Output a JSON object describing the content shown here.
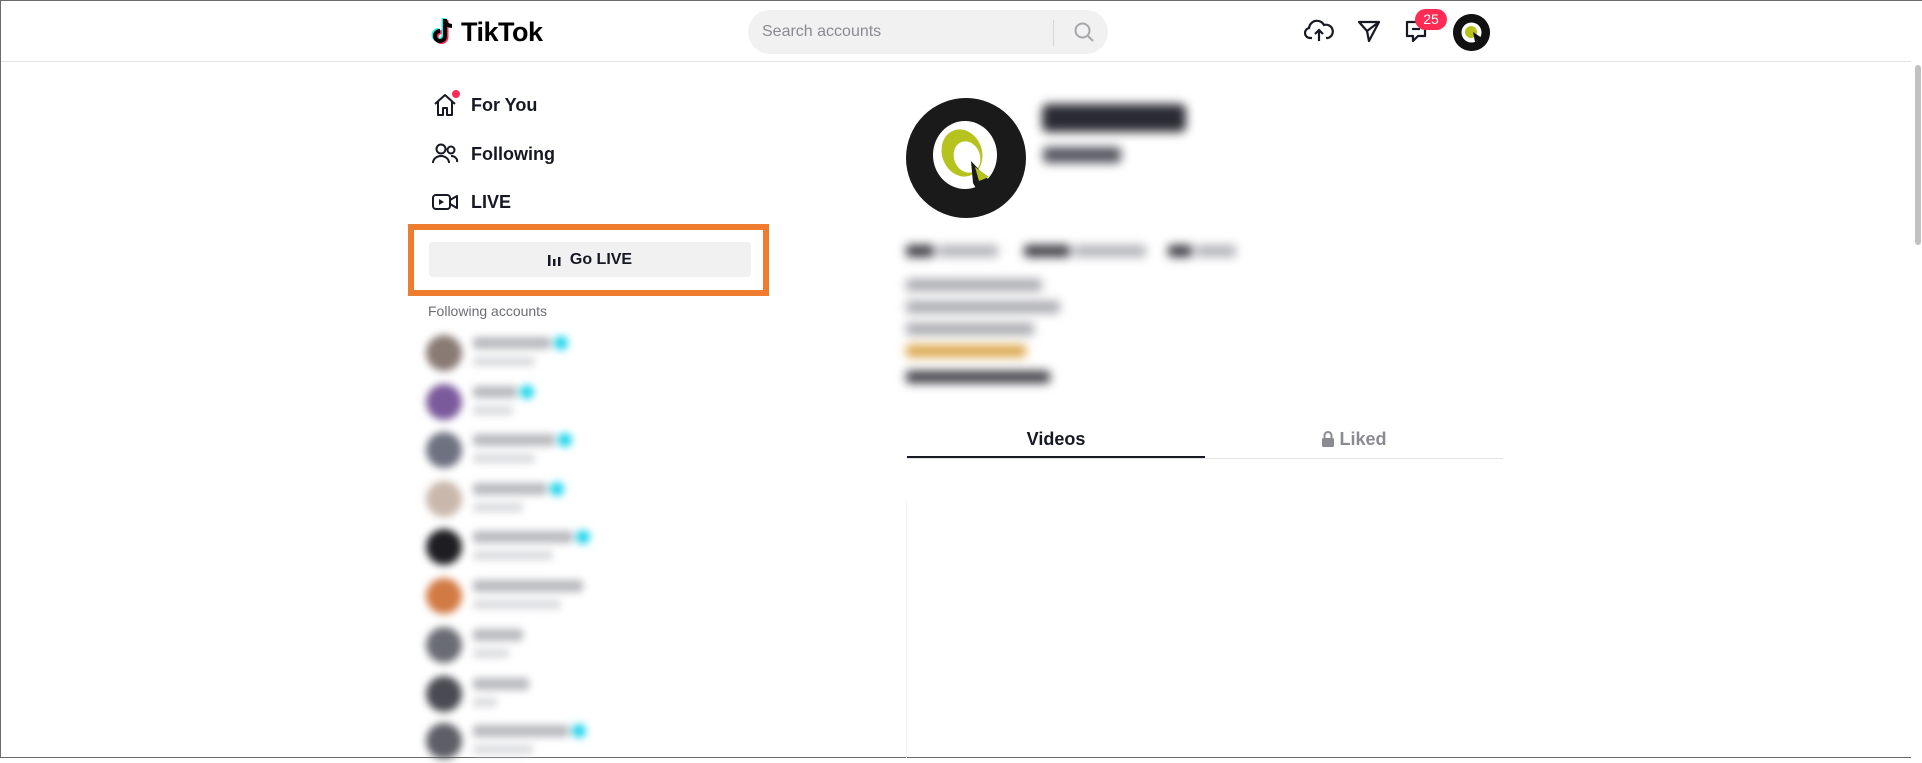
{
  "header": {
    "logo_text": "TikTok",
    "search": {
      "placeholder": "Search accounts"
    },
    "inbox_badge": "25",
    "icons": [
      "upload-icon",
      "send-icon",
      "inbox-icon",
      "search-icon"
    ]
  },
  "sidebar": {
    "nav": [
      {
        "label": "For You",
        "icon": "home-icon",
        "has_dot": true
      },
      {
        "label": "Following",
        "icon": "people-icon"
      },
      {
        "label": "LIVE",
        "icon": "live-camera-icon"
      }
    ],
    "go_live_label": "Go LIVE",
    "following_title": "Following accounts"
  },
  "profile": {
    "tabs": {
      "videos": "Videos",
      "liked": "Liked"
    },
    "selected_tab": "Videos"
  },
  "colors": {
    "accent": "#fe2c55",
    "highlight_box": "#ef7d2f",
    "verified": "#20d5ec",
    "avatar_green": "#b6c21e"
  }
}
